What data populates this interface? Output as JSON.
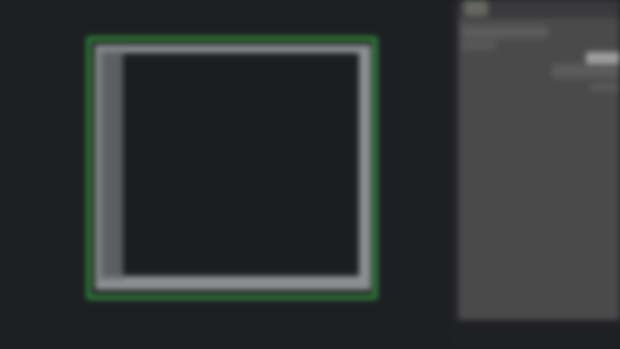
{
  "app": {
    "title": ""
  },
  "canvas": {
    "frame_label": ""
  },
  "inspector": {
    "title": "",
    "rows": [
      "",
      "",
      "",
      ""
    ],
    "accent": "#2e7f35"
  },
  "icons": {
    "panel": "panel-icon"
  }
}
